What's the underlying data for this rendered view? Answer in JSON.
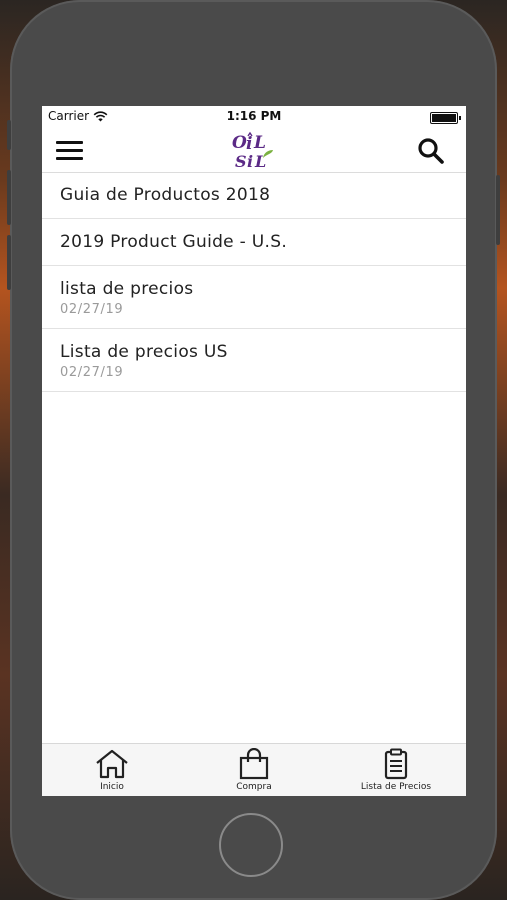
{
  "status_bar": {
    "carrier": "Carrier",
    "time": "1:16 PM"
  },
  "nav": {
    "logo_text": "OiL SiL",
    "menu_icon": "hamburger-menu-icon",
    "search_icon": "search-icon"
  },
  "documents": [
    {
      "title": "Guia de Productos 2018",
      "date": ""
    },
    {
      "title": "2019 Product Guide - U.S.",
      "date": ""
    },
    {
      "title": "lista de precios",
      "date": "02/27/19"
    },
    {
      "title": "Lista de precios US",
      "date": "02/27/19"
    }
  ],
  "tabs": [
    {
      "label": "Inicio",
      "icon": "home-icon"
    },
    {
      "label": "Compra",
      "icon": "shopping-bag-icon"
    },
    {
      "label": "Lista de Precios",
      "icon": "clipboard-list-icon"
    }
  ],
  "colors": {
    "logo_purple": "#5b2a86",
    "logo_green": "#7bb241"
  }
}
